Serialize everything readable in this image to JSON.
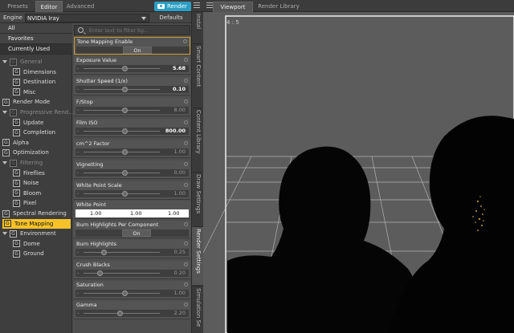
{
  "top_tabs": [
    "Presets",
    "Editor",
    "Advanced"
  ],
  "render_button": "Render",
  "engine": {
    "label": "Engine :",
    "value": "NVIDIA Iray",
    "defaults": "Defaults"
  },
  "categories": [
    "All",
    "Favorites",
    "Currently Used"
  ],
  "tree": [
    {
      "label": "General",
      "level": 0,
      "dim": true,
      "arrow": true
    },
    {
      "label": "Dimensions",
      "level": 1
    },
    {
      "label": "Destination",
      "level": 1
    },
    {
      "label": "Misc",
      "level": 1
    },
    {
      "label": "Render Mode",
      "level": 0
    },
    {
      "label": "Progressive Rend...",
      "level": 0,
      "dim": true,
      "arrow": true
    },
    {
      "label": "Update",
      "level": 1
    },
    {
      "label": "Completion",
      "level": 1
    },
    {
      "label": "Alpha",
      "level": 0
    },
    {
      "label": "Optimization",
      "level": 0
    },
    {
      "label": "Filtering",
      "level": 0,
      "dim": true,
      "arrow": true
    },
    {
      "label": "Fireflies",
      "level": 1
    },
    {
      "label": "Noise",
      "level": 1
    },
    {
      "label": "Bloom",
      "level": 1
    },
    {
      "label": "Pixel",
      "level": 1
    },
    {
      "label": "Spectral Rendering",
      "level": 0
    },
    {
      "label": "Tone Mapping",
      "level": 0,
      "highlight": true
    },
    {
      "label": "Environment",
      "level": 0,
      "arrow": true
    },
    {
      "label": "Dome",
      "level": 1
    },
    {
      "label": "Ground",
      "level": 1
    }
  ],
  "filter_placeholder": "Enter text to filter by...",
  "properties": {
    "tone_mapping_enable": {
      "label": "Tone Mapping Enable",
      "value": "On"
    },
    "exposure": {
      "label": "Exposure Value",
      "value": "5.68"
    },
    "shutter": {
      "label": "Shutter Speed (1/x)",
      "value": "0.10"
    },
    "fstop": {
      "label": "F/Stop",
      "value": "8.00"
    },
    "iso": {
      "label": "Film ISO",
      "value": "800.00"
    },
    "cm2": {
      "label": "cm^2 Factor",
      "value": "1.00"
    },
    "vignetting": {
      "label": "Vignetting",
      "value": "0.00"
    },
    "wps": {
      "label": "White Point Scale",
      "value": "1.00"
    },
    "white_point": {
      "label": "White Point",
      "r": "1.00",
      "g": "1.00",
      "b": "1.00"
    },
    "burn_per_component": {
      "label": "Burn Highlights Per Component",
      "value": "On"
    },
    "burn": {
      "label": "Burn Highlights",
      "value": "0.25"
    },
    "crush": {
      "label": "Crush Blacks",
      "value": "0.20"
    },
    "saturation": {
      "label": "Saturation",
      "value": "1.00"
    },
    "gamma": {
      "label": "Gamma",
      "value": "2.20"
    }
  },
  "side_tabs": [
    "Instal",
    "Smart Content",
    "Content Library",
    "Draw Settings",
    "Render Settings",
    "Simulation Se"
  ],
  "viewport_tabs": [
    "Viewport",
    "Render Library"
  ],
  "aspect_ratio": "4 : 5"
}
